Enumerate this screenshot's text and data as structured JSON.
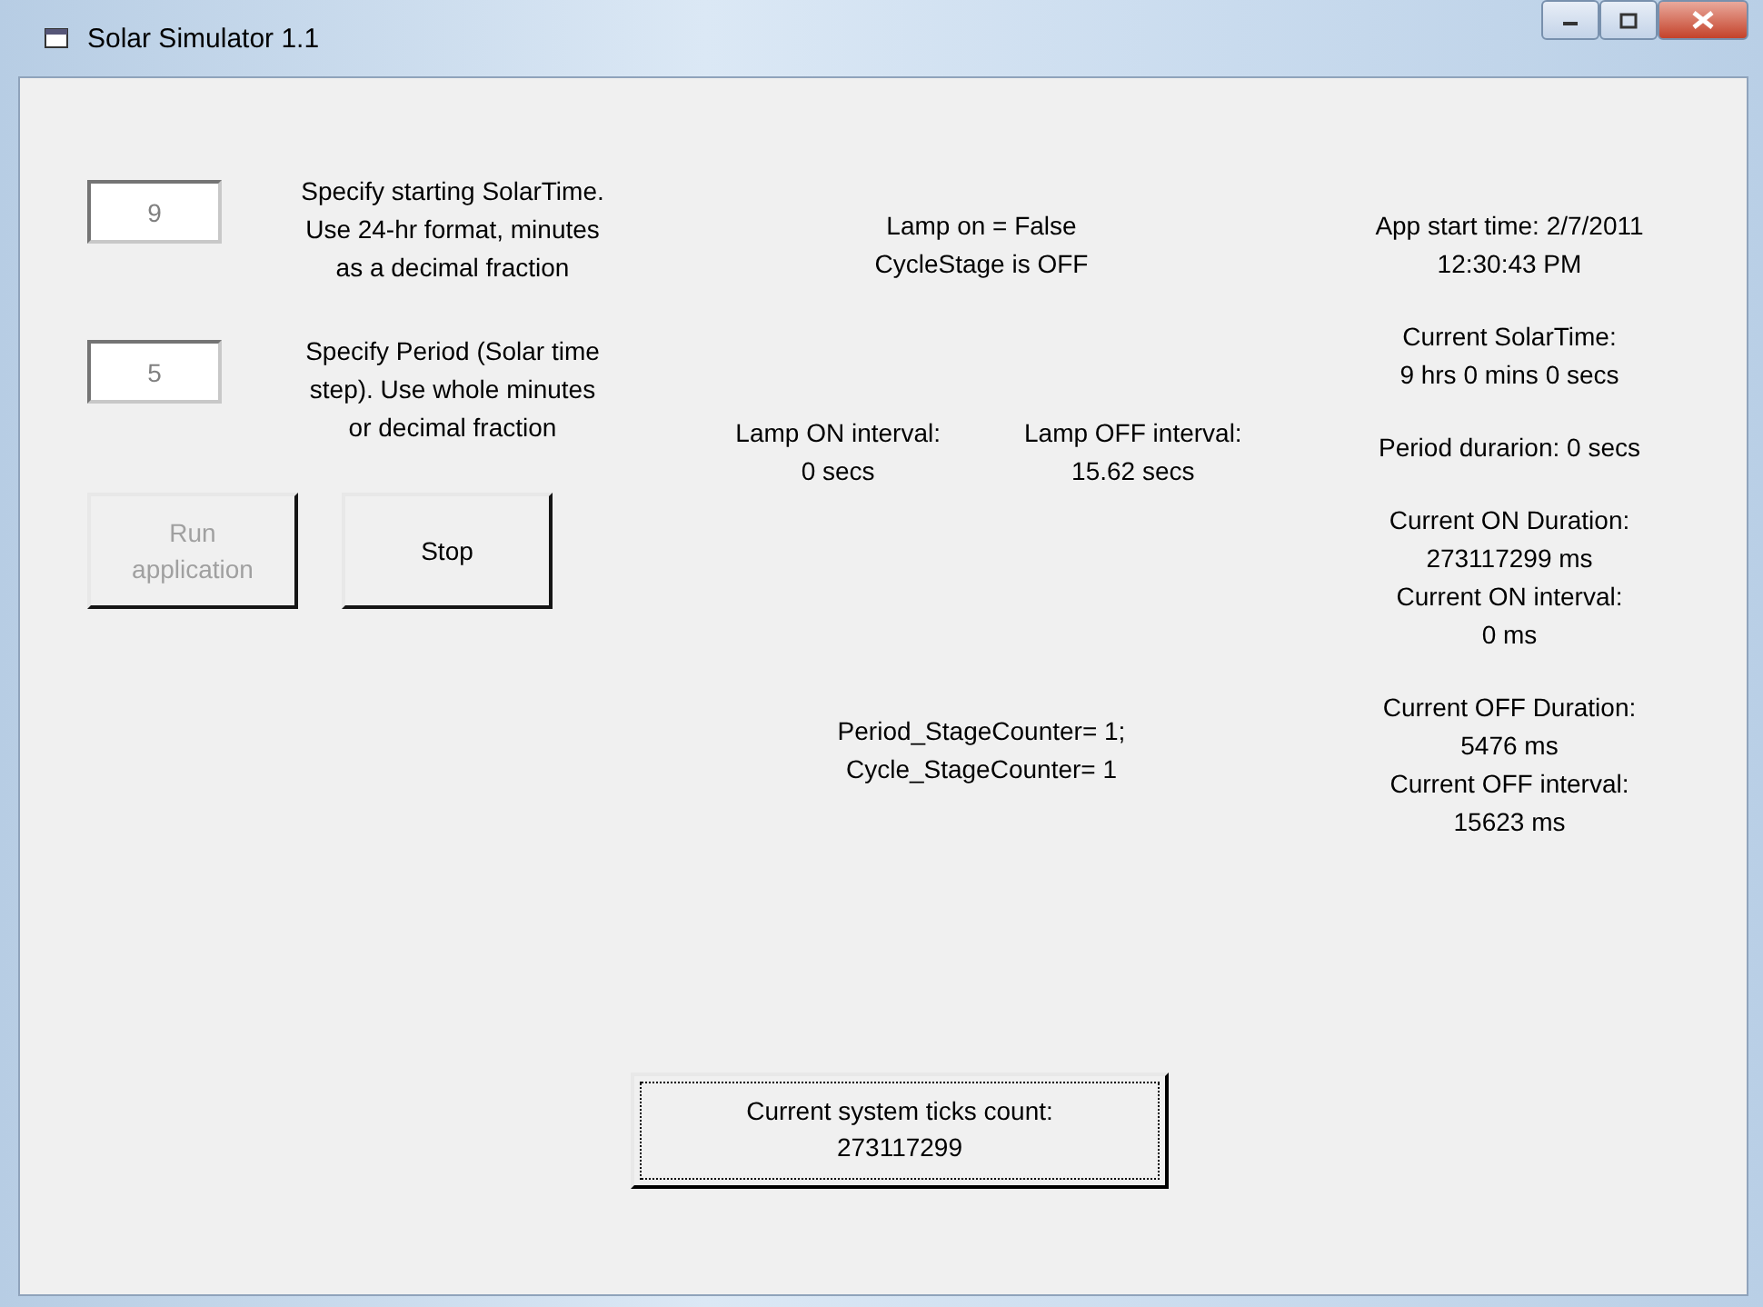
{
  "window": {
    "title": "Solar Simulator 1.1"
  },
  "inputs": [
    {
      "value": "9",
      "label": [
        "Specify starting SolarTime.",
        "Use 24-hr format, minutes",
        "as a decimal fraction"
      ]
    },
    {
      "value": "5",
      "label": [
        "Specify Period (Solar time",
        "step). Use whole minutes",
        "or decimal fraction"
      ]
    }
  ],
  "buttons": [
    {
      "label": [
        "Run",
        "application"
      ],
      "disabled": true
    },
    {
      "label": [
        "Stop"
      ],
      "disabled": false
    }
  ],
  "lamp_status": [
    "Lamp on = False",
    "CycleStage is OFF"
  ],
  "intervals": [
    {
      "lines": [
        "Lamp ON interval:",
        "0 secs"
      ]
    },
    {
      "lines": [
        "Lamp OFF interval:",
        "15.62 secs"
      ]
    }
  ],
  "counters": [
    "Period_StageCounter= 1;",
    "Cycle_StageCounter= 1"
  ],
  "readout_groups": [
    [
      {
        "lines": [
          "App start time: 2/7/2011",
          "12:30:43 PM"
        ]
      }
    ],
    [
      {
        "lines": [
          "Current SolarTime:",
          "9 hrs 0 mins 0 secs"
        ]
      }
    ],
    [
      {
        "lines": [
          "Period durarion: 0 secs"
        ]
      }
    ],
    [
      {
        "lines": [
          "Current ON Duration:",
          "273117299 ms"
        ]
      },
      {
        "lines": [
          "Current ON interval:",
          "0 ms"
        ]
      }
    ],
    [
      {
        "lines": [
          "Current OFF Duration:",
          "5476 ms"
        ]
      },
      {
        "lines": [
          "Current OFF interval:",
          "15623 ms"
        ]
      }
    ]
  ],
  "ticks_button": {
    "lines": [
      "Current system ticks count:",
      "273117299"
    ],
    "focused": true
  }
}
